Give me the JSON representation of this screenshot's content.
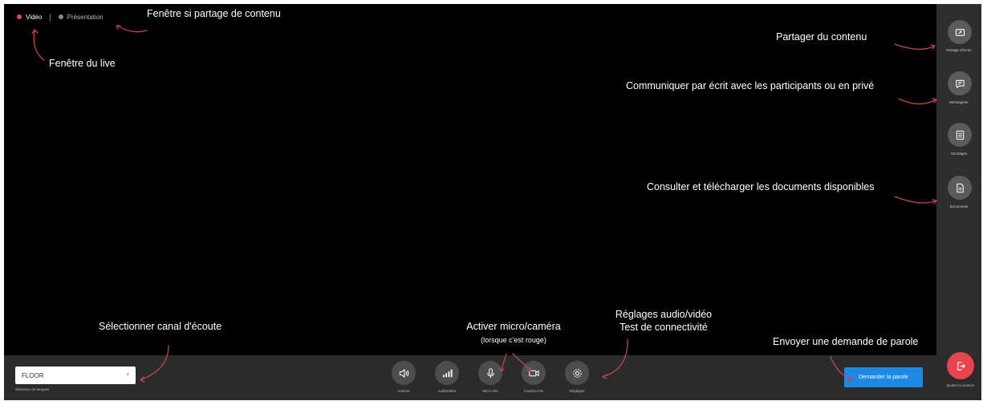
{
  "tabs": [
    {
      "label": "Vidéo",
      "dot_color": "#e8444f",
      "active": true
    },
    {
      "label": "Présentation",
      "dot_color": "#888888",
      "active": false
    }
  ],
  "tab_separator": "|",
  "sidebar": {
    "items": [
      {
        "label": "Partage d'écran",
        "icon": "screen-share-icon"
      },
      {
        "label": "Messagerie",
        "icon": "chat-icon"
      },
      {
        "label": "Sondages",
        "icon": "poll-icon"
      },
      {
        "label": "Documents",
        "icon": "document-icon"
      }
    ]
  },
  "bottombar": {
    "language_select": {
      "value": "FLOOR",
      "label": "Sélecteur de langues"
    },
    "controls": [
      {
        "label": "Volume",
        "icon": "speaker-icon"
      },
      {
        "label": "Audiomètre",
        "icon": "level-meter-icon"
      },
      {
        "label": "Micro ON",
        "icon": "microphone-icon"
      },
      {
        "label": "Caméra ON",
        "icon": "camera-icon"
      },
      {
        "label": "Réglages",
        "icon": "gear-icon"
      }
    ],
    "request_button": "Demander la parole",
    "quit_label": "Quitter la session"
  },
  "annotations": {
    "share_window": "Fenêtre si partage de contenu",
    "live_window": "Fenêtre du live",
    "share_content": "Partager du contenu",
    "messaging": "Communiquer par écrit avec les participants ou en privé",
    "documents": "Consulter et télécharger les documents disponibles",
    "channel": "Sélectionner canal d'écoute",
    "mic_cam": "Activer micro/caméra",
    "mic_cam_note": "(lorsque c'est rouge)",
    "settings_line1": "Réglages audio/vidéo",
    "settings_line2": "Test de connectivité",
    "request": "Envoyer une demande de parole"
  },
  "colors": {
    "accent_blue": "#1e88e5",
    "accent_red": "#e8444f",
    "background": "#000000"
  }
}
